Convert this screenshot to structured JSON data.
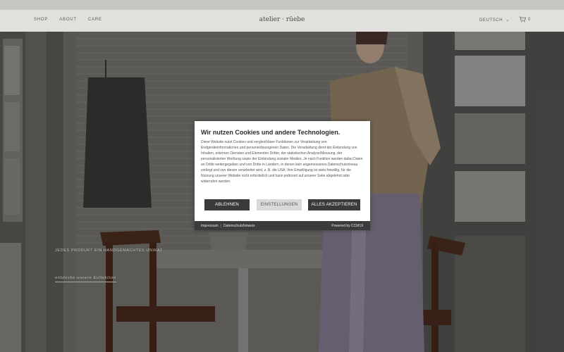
{
  "header": {
    "nav": [
      "SHOP",
      "ABOUT",
      "CARE"
    ],
    "brand": "atelier · rüebe",
    "language": "DEUTSCH",
    "cart_count": "0"
  },
  "hero": {
    "tagline": "JEDES PRODUKT EIN HANDGEMACHTES UNIKAT",
    "cta": "entdecke unsere Kollektion"
  },
  "cookie_dialog": {
    "title": "Wir nutzen Cookies und andere Technologien.",
    "body": "Diese Website nutzt Cookies und vergleichbare Funktionen zur Verarbeitung von Endgeräteinformationen und personenbezogenen Daten. Die Verarbeitung dient der Einbindung von Inhalten, externen Diensten und Elementen Dritter, der statistischen Analyse/Messung, der personalisierten Werbung sowie der Einbindung sozialer Medien. Je nach Funktion werden dabei Daten an Dritte weitergegeben und von Dritte in Ländern, in denen kein angemessenes Datenschutzniveau vorliegt und von diesen verarbeitet wird, z. B. die USA. Ihre Einwilligung ist stets freiwillig, für die Nutzung unserer Website nicht erforderlich und kann jederzeit auf unserer Seite abgelehnt oder widerrufen werden.",
    "btn_decline": "ABLEHNEN",
    "btn_settings": "EINSTELLUNGEN",
    "btn_accept": "ALLES AKZEPTIEREN",
    "link_imprint": "Impressum",
    "link_privacy": "Datenschutzhinweis",
    "powered_by": "Powered by CCM19"
  },
  "colors": {
    "header_bg": "#e1e0dc",
    "dialog_bg": "#ffffff",
    "button_dark": "#3a3a3a",
    "button_light": "#d9d9d9"
  }
}
